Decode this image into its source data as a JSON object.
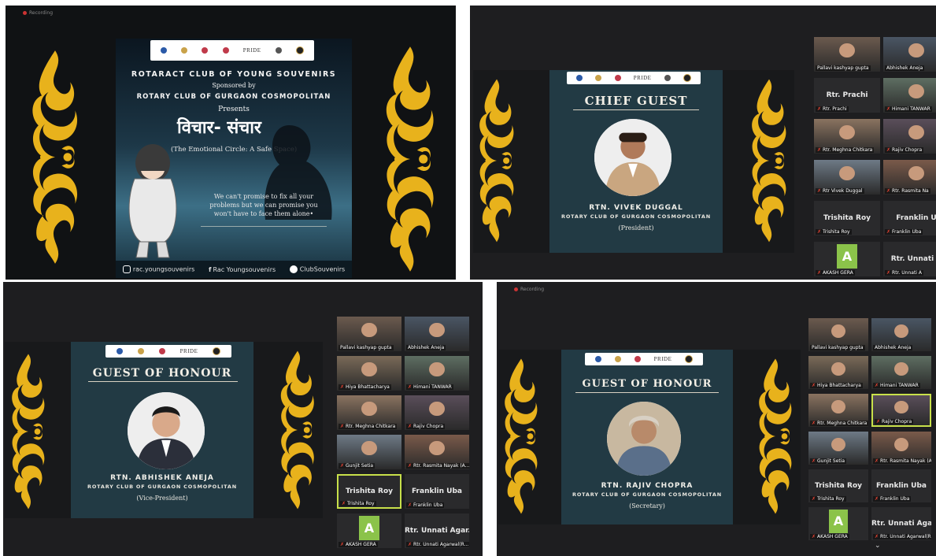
{
  "panel1": {
    "recording": "Recording",
    "title": "ROTARACT CLUB OF YOUNG SOUVENIRS",
    "sponsored": "Sponsored by",
    "sponsor": "ROTARY CLUB OF GURGAON COSMOPOLITAN",
    "presents": "Presents",
    "event_hindi": "विचार- संचार",
    "event_sub": "(The Emotional Circle: A Safe Space)",
    "quote": "We can't promise to fix all your problems but we can promise you won't have to face them alone•",
    "social": [
      {
        "icon": "instagram-icon",
        "label": "rac.youngsouvenirs"
      },
      {
        "icon": "facebook-icon",
        "label": "Rac Youngsouvenirs"
      },
      {
        "icon": "twitter-icon",
        "label": "ClubSouvenirs"
      }
    ]
  },
  "panel2": {
    "heading": "CHIEF GUEST",
    "name": "RTN. VIVEK DUGGAL",
    "club": "ROTARY CLUB OF GURGAON COSMOPOLITAN",
    "role": "(President)",
    "participants": [
      {
        "label": "Pallavi kashyap gupta",
        "type": "video"
      },
      {
        "label": "Abhishek Aneja",
        "type": "video"
      },
      {
        "big": "Rtr. Prachi",
        "label": "Rtr. Prachi",
        "type": "name"
      },
      {
        "label": "Himani TANWAR",
        "type": "video"
      },
      {
        "label": "Rtr. Meghna Chitkara",
        "type": "video"
      },
      {
        "label": "Rajiv Chopra",
        "type": "video"
      },
      {
        "label": "Rtr Vivek Duggal",
        "type": "video"
      },
      {
        "label": "Rtr. Rasmita Na",
        "type": "video"
      },
      {
        "big": "Trishita Roy",
        "label": "Trishita Roy",
        "type": "name"
      },
      {
        "big": "Franklin U",
        "label": "Franklin Uba",
        "type": "name"
      },
      {
        "avatar": "A",
        "label": "AKASH GERA",
        "type": "avatar"
      },
      {
        "big": "Rtr. Unnati A",
        "label": "Rtr. Unnati A",
        "type": "name"
      }
    ]
  },
  "panel3": {
    "heading": "GUEST OF HONOUR",
    "name": "RTN. ABHISHEK ANEJA",
    "club": "ROTARY CLUB OF GURGAON COSMOPOLITAN",
    "role": "(Vice-President)",
    "participants": [
      {
        "label": "Pallavi kashyap gupta",
        "type": "video"
      },
      {
        "label": "Abhishek Aneja",
        "type": "video"
      },
      {
        "label": "Hiya Bhattacharya",
        "type": "video"
      },
      {
        "label": "Himani TANWAR",
        "type": "video"
      },
      {
        "label": "Rtr. Meghna Chitkara",
        "type": "video"
      },
      {
        "label": "Rajiv Chopra",
        "type": "video"
      },
      {
        "label": "Gunjit Setia",
        "type": "video"
      },
      {
        "label": "Rtr. Rasmita Nayak (A...",
        "type": "video"
      },
      {
        "big": "Trishita Roy",
        "label": "Trishita Roy",
        "type": "name",
        "highlight": true
      },
      {
        "big": "Franklin Uba",
        "label": "Franklin Uba",
        "type": "name"
      },
      {
        "avatar": "A",
        "label": "AKASH GERA",
        "type": "avatar"
      },
      {
        "big": "Rtr. Unnati Agar...",
        "label": "Rtr. Unnati Agarwal(R...",
        "type": "name"
      }
    ]
  },
  "panel4": {
    "recording": "Recording",
    "heading": "GUEST OF HONOUR",
    "name": "RTN. RAJIV CHOPRA",
    "club": "ROTARY CLUB OF GURGAON COSMOPOLITAN",
    "role": "(Secretary)",
    "participants": [
      {
        "label": "Pallavi kashyap gupta",
        "type": "video"
      },
      {
        "label": "Abhishek Aneja",
        "type": "video"
      },
      {
        "label": "Hiya Bhattacharya",
        "type": "video"
      },
      {
        "label": "Himani TANWAR",
        "type": "video"
      },
      {
        "label": "Rtr. Meghna Chitkara",
        "type": "video"
      },
      {
        "label": "Rajiv Chopra",
        "type": "video",
        "highlight": true
      },
      {
        "label": "Gunjit Setia",
        "type": "video"
      },
      {
        "label": "Rtr. Rasmita Nayak (A...",
        "type": "video"
      },
      {
        "big": "Trishita Roy",
        "label": "Trishita Roy",
        "type": "name"
      },
      {
        "big": "Franklin Uba",
        "label": "Franklin Uba",
        "type": "name"
      },
      {
        "avatar": "A",
        "label": "AKASH GERA",
        "type": "avatar"
      },
      {
        "big": "Rtr. Unnati Agar",
        "label": "Rtr. Unnati Agarwal(R",
        "type": "name"
      }
    ]
  },
  "logo_text": "PRIDE",
  "colors": {
    "slide_bg": "#223a44",
    "gold": "#e8b21c",
    "avatar_green": "#8bc34a",
    "mute_red": "#e43"
  }
}
